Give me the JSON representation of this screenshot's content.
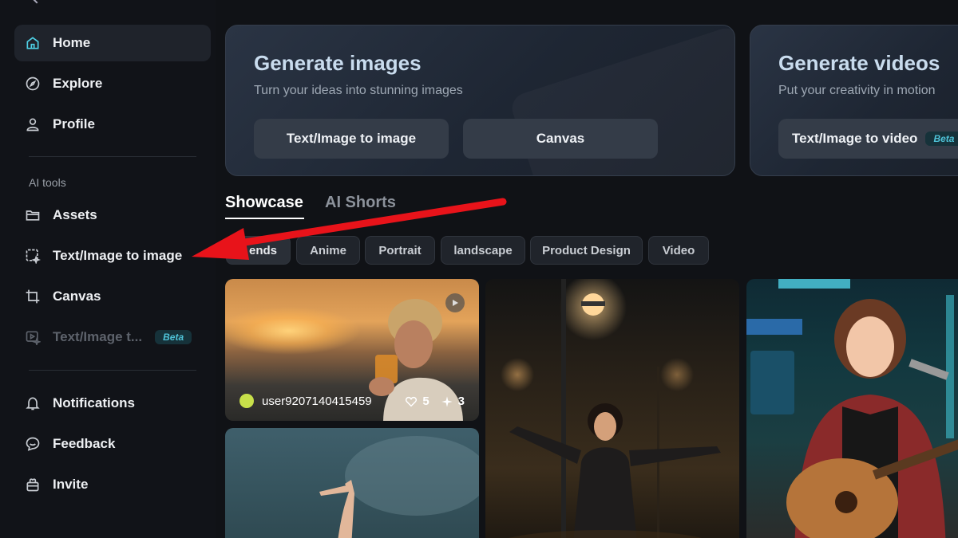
{
  "sidebar": {
    "items": [
      {
        "label": "Home",
        "icon": "home-icon"
      },
      {
        "label": "Explore",
        "icon": "compass-icon"
      },
      {
        "label": "Profile",
        "icon": "user-icon"
      }
    ],
    "section_label": "AI tools",
    "tools": [
      {
        "label": "Assets",
        "icon": "folder-icon"
      },
      {
        "label": "Text/Image to image",
        "icon": "image-sparkle-icon"
      },
      {
        "label": "Canvas",
        "icon": "crop-icon"
      },
      {
        "label": "Text/Image t...",
        "icon": "video-sparkle-icon",
        "badge": "Beta"
      }
    ],
    "bottom": [
      {
        "label": "Notifications",
        "icon": "bell-icon"
      },
      {
        "label": "Feedback",
        "icon": "chat-icon"
      },
      {
        "label": "Invite",
        "icon": "gift-icon"
      }
    ]
  },
  "hero": {
    "images": {
      "title": "Generate images",
      "subtitle": "Turn your ideas into stunning images",
      "buttons": [
        "Text/Image to image",
        "Canvas"
      ]
    },
    "videos": {
      "title": "Generate videos",
      "subtitle": "Put your creativity in motion",
      "button": "Text/Image to video",
      "badge": "Beta"
    }
  },
  "tabs": [
    "Showcase",
    "AI Shorts"
  ],
  "chips": [
    "ends",
    "Anime",
    "Portrait",
    "landscape",
    "Product Design",
    "Video"
  ],
  "gallery": {
    "card1": {
      "username": "user9207140415459",
      "likes": "5",
      "remixes": "3"
    }
  },
  "colors": {
    "background": "#101216",
    "accent_beta": "#4fc3d8",
    "annotation_arrow": "#e8131a"
  }
}
